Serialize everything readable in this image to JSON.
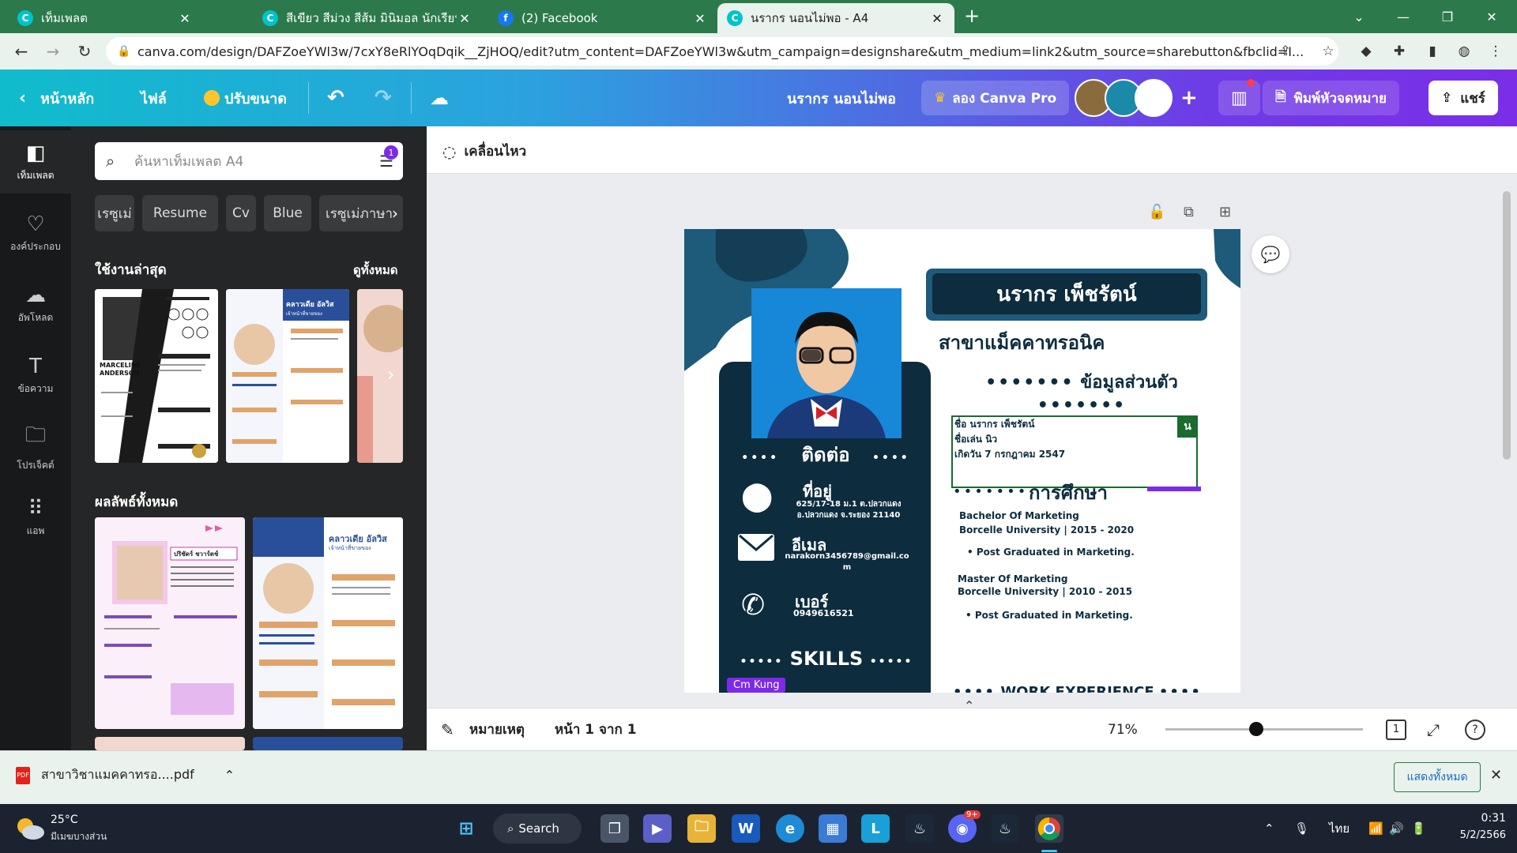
{
  "browser": {
    "tabs": [
      {
        "title": "เท็มเพลต",
        "icon": "canva-icon",
        "color": "#00c4cc"
      },
      {
        "title": "สีเขียว สีม่วง สีส้ม มินิมอล นักเรียน เรซูเ",
        "icon": "canva-icon",
        "color": "#00c4cc"
      },
      {
        "title": "(2) Facebook",
        "icon": "facebook-icon",
        "color": "#1877f2"
      },
      {
        "title": "นรากร นอนไม่พอ - A4",
        "icon": "canva-icon",
        "color": "#00c4cc"
      }
    ],
    "url": "canva.com/design/DAFZoeYWl3w/7cxY8eRlYOqDqik__ZjHOQ/edit?utm_content=DAFZoeYWl3w&utm_campaign=designshare&utm_medium=link2&utm_source=sharebutton&fbclid=I..."
  },
  "header": {
    "home": "หน้าหลัก",
    "file": "ไฟล์",
    "resize": "ปรับขนาด",
    "doc_title": "นรากร นอนไม่พอ",
    "try_pro": "ลอง Canva Pro",
    "print": "พิมพ์หัวจดหมาย",
    "share": "แชร์"
  },
  "rail": [
    {
      "label": "เท็มเพลต",
      "icon": "template-icon"
    },
    {
      "label": "องค์ประกอบ",
      "icon": "elements-icon"
    },
    {
      "label": "อัพโหลด",
      "icon": "upload-icon"
    },
    {
      "label": "ข้อความ",
      "icon": "text-icon"
    },
    {
      "label": "โปรเจ็คต์",
      "icon": "folder-icon"
    },
    {
      "label": "แอพ",
      "icon": "apps-icon"
    }
  ],
  "panel": {
    "search_placeholder": "ค้นหาเท็มเพลต A4",
    "filter_count": "1",
    "chips": [
      "เรซูเม่",
      "Resume",
      "Cv",
      "Blue",
      "เรซูเม่ภาษา"
    ],
    "recent_title": "ใช้งานล่าสุด",
    "see_all": "ดูทั้งหมด",
    "results_title": "ผลลัพธ์ทั้งหมด",
    "thumb1_name": "MARCELINE ANDERSON",
    "thumb2_name": "คลาวเดีย อัลวิส",
    "thumb2_role": "เจ้าหน้าที่ขายของ",
    "result1_name": "ปริชัดร์ ชวาร์ตช์",
    "result2_name": "คลาวเดีย อัลวิส",
    "result2_role": "เจ้าหน้าที่ขายของ"
  },
  "editor": {
    "animate": "เคลื่อนไหว",
    "notes": "หมายเหตุ",
    "page_info": "หน้า 1 จาก 1",
    "zoom": "71%",
    "zoom_fraction": 0.46,
    "page_count": "1"
  },
  "resume": {
    "name": "นรากร เพ็ชรัตน์",
    "major": "สาขาแม็คคาทรอนิค",
    "personal_heading": "ข้อมูลส่วนตัว",
    "personal_lines": [
      "ชื่อ นรากร เพ็ชรัตน์",
      "ชื่อเล่น นิว",
      "เกิดวัน 7 กรกฎาคม 2547"
    ],
    "contact_heading": "ติดต่อ",
    "address_label": "ที่อยู่",
    "address_value": "625/17-18 ม.1 ต.ปลวกแดง อ.ปลวกแดง จ.ระยอง 21140",
    "email_label": "อีเมล",
    "email_value": "narakorn3456789@gmail.com",
    "phone_label": "เบอร์",
    "phone_value": "0949616521",
    "skills_heading": "SKILLS",
    "skills_chip": "Cm Kung",
    "edu_heading": "การศึกษา",
    "edu": [
      {
        "degree": "Bachelor Of Marketing",
        "school": "Borcelle University | 2015 - 2020",
        "bullet": "Post Graduated in Marketing."
      },
      {
        "degree": "Master Of Marketing",
        "school": "Borcelle University | 2010 - 2015",
        "bullet": "Post Graduated in Marketing."
      }
    ],
    "work_heading": "WORK EXPERIENCE",
    "collab_tag": "น",
    "colors": {
      "navy": "#0d2c3e",
      "teal": "#1e5a7a",
      "purple": "#7d2ae8",
      "green": "#1a6b2e"
    }
  },
  "download": {
    "filename": "สาขาวิชาแมคคาทรอ....pdf",
    "show_all": "แสดงทั้งหมด"
  },
  "taskbar": {
    "weather_temp": "25°C",
    "weather_desc": "มีเมฆบางส่วน",
    "search": "Search",
    "lang": "ไทย",
    "time": "0:31",
    "date": "5/2/2566",
    "discord_badge": "9+"
  }
}
